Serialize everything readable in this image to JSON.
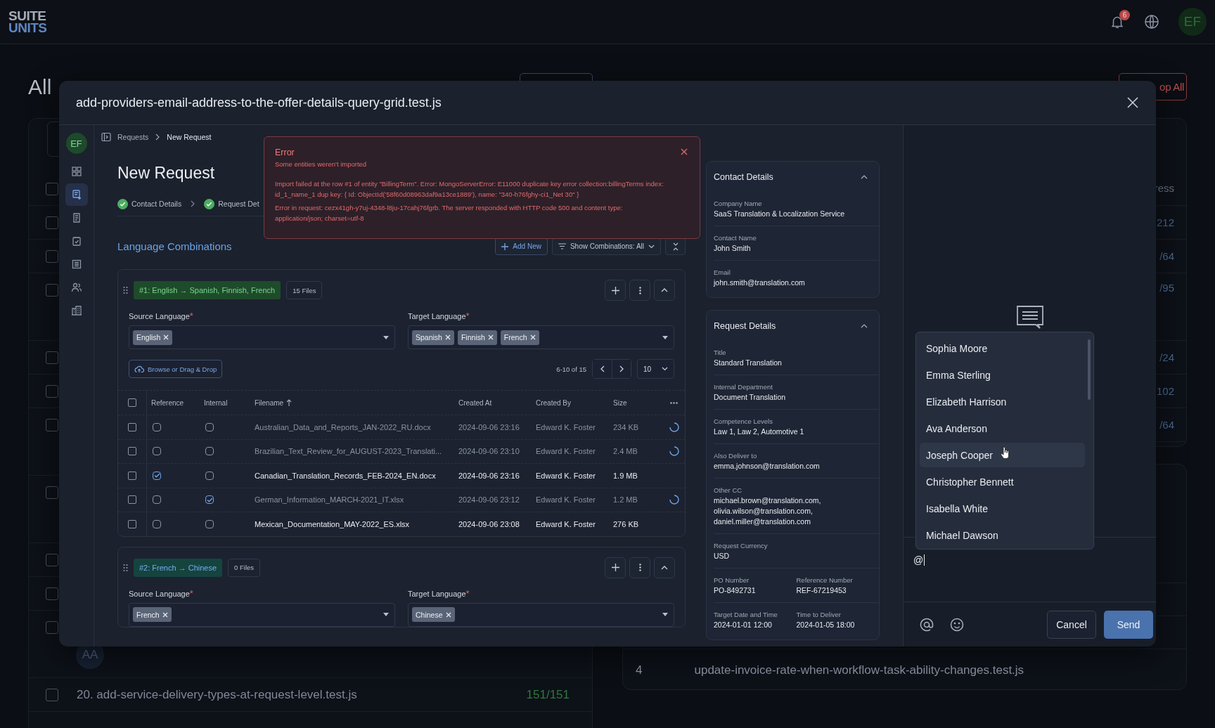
{
  "app_header": {
    "logo_top": "SUITE",
    "logo_bottom": "UNITS",
    "notification_count": "6",
    "avatar": "EF"
  },
  "background": {
    "title": "All",
    "stop_button": "op All",
    "left_rows": [
      {
        "checked": false
      },
      {
        "checked": false
      },
      {
        "checked": false
      },
      {
        "checked": false
      },
      {
        "checked": false
      },
      {
        "checked": false
      },
      {
        "checked": false
      },
      {
        "checked": false
      },
      {
        "checked": false
      },
      {
        "checked": false
      },
      {
        "checked": false
      }
    ],
    "avatar": "AA",
    "list_rows": [
      {
        "name": "20. add-service-delivery-types-at-request-level.test.js",
        "progress": "151/151",
        "checked": false,
        "passed": true
      }
    ],
    "right_header": "ress",
    "right_values": [
      "212",
      "/64",
      "/95",
      "/24",
      "102",
      "/64"
    ],
    "second_card_row": {
      "index": "4",
      "name": "update-invoice-rate-when-workflow-task-ability-changes.test.js"
    }
  },
  "modal": {
    "title": "add-providers-email-address-to-the-offer-details-query-grid.test.js",
    "user_avatar": "EF",
    "nav_items": [
      {
        "kind": "grid",
        "selected": false
      },
      {
        "kind": "new-request",
        "selected": true
      },
      {
        "kind": "invoice",
        "selected": false
      },
      {
        "kind": "tasks",
        "selected": false
      },
      {
        "kind": "list",
        "selected": false
      },
      {
        "kind": "people",
        "selected": false
      },
      {
        "kind": "company",
        "selected": false
      }
    ],
    "breadcrumb": [
      "Requests",
      "New Request"
    ],
    "page_title": "New Request",
    "steps": [
      {
        "label": "Contact Details",
        "done": true
      },
      {
        "label": "Request Det",
        "done": true
      }
    ],
    "error": {
      "title": "Error",
      "subtitle": "Some entities weren't imported",
      "messages": [
        "Import failed at the row #1 of entity \"BillingTerm\". Error: MongoServerError: E11000 duplicate key error collection:billingTerms index: id_1_name_1 dup key: { Id: ObjectId('58f60d08963daf9a13ce1889'), name: \"340-h76fghy-ci1_Net 30\" }",
        "Error in request: cezx41gh-y7uj-4348-l8ju-17cahj76fgrb. The server responded with HTTP code 500 and content type: application/json; charset=utf-8"
      ]
    },
    "section_title": "Language Combinations",
    "add_button": "Add New",
    "filter_button": "Show Combinations: All",
    "combinations": [
      {
        "kind": "with-files",
        "tag": "#1: English → Spanish,  Finnish, French",
        "files_count": "15 Files",
        "required_mark": "*",
        "all_selected": false,
        "source_label": "Source Language",
        "source": [
          "English"
        ],
        "target_label": "Target Language",
        "targets": [
          "Spanish",
          "Finnish",
          "French"
        ],
        "browse_button": "Browse or Drag & Drop",
        "pagination": "6-10 of 15",
        "page_size": "10",
        "columns": [
          "Reference",
          "Internal",
          "Filename",
          "Created At",
          "Created By",
          "Size"
        ],
        "rows": [
          {
            "selected": false,
            "reference": false,
            "internal": false,
            "filename": "Australian_Data_and_Reports_JAN-2022_RU.docx",
            "created_at": "2024-09-06 23:16",
            "created_by": "Edward K. Foster",
            "size": "234 KB",
            "processing": true
          },
          {
            "selected": false,
            "reference": false,
            "internal": false,
            "filename": "Brazilian_Text_Review_for_AUGUST-2023_Translati...",
            "created_at": "2024-09-06 23:10",
            "created_by": "Edward K. Foster",
            "size": "2.4 MB",
            "processing": true
          },
          {
            "selected": false,
            "reference": true,
            "internal": false,
            "filename": "Canadian_Translation_Records_FEB-2024_EN.docx",
            "created_at": "2024-09-06 23:16",
            "created_by": "Edward K. Foster",
            "size": "1.9 MB",
            "processing": false
          },
          {
            "selected": false,
            "reference": false,
            "internal": true,
            "filename": "German_Information_MARCH-2021_IT.xlsx",
            "created_at": "2024-09-06 23:12",
            "created_by": "Edward K. Foster",
            "size": "1.2 MB",
            "processing": true
          },
          {
            "selected": false,
            "reference": false,
            "internal": false,
            "filename": "Mexican_Documentation_MAY-2022_ES.xlsx",
            "created_at": "2024-09-06 23:08",
            "created_by": "Edward K. Foster",
            "size": "276 KB",
            "processing": false
          }
        ]
      },
      {
        "kind": "no-files",
        "tag": "#2: French → Chinese",
        "files_count": "0 Files",
        "required_mark": "*",
        "source_label": "Source Language",
        "source": [
          "French"
        ],
        "target_label": "Target Language",
        "targets": [
          "Chinese"
        ]
      }
    ],
    "details": [
      {
        "title": "Contact Details",
        "expanded": true,
        "fields": [
          {
            "kind": "text",
            "label": "Company Name",
            "value": "SaaS Translation & Localization Service"
          },
          {
            "kind": "text",
            "label": "Contact Name",
            "value": "John Smith"
          },
          {
            "kind": "text",
            "label": "Email",
            "value": "john.smith@translation.com"
          }
        ]
      },
      {
        "title": "Request Details",
        "expanded": true,
        "fields": [
          {
            "kind": "text",
            "label": "Title",
            "value": "Standard Translation"
          },
          {
            "kind": "text",
            "label": "Internal Department",
            "value": "Document Translation"
          },
          {
            "kind": "text",
            "label": "Competence Levels",
            "value": "Law 1, Law 2, Automotive 1"
          },
          {
            "kind": "text",
            "label": "Also Deliver to",
            "value": "emma.johnson@translation.com"
          },
          {
            "kind": "lines",
            "label": "Other CC",
            "lines": [
              "michael.brown@translation.com,",
              "olivia.wilson@translation.com,",
              "daniel.miller@translation.com"
            ]
          },
          {
            "kind": "text",
            "label": "Request Currency",
            "value": "USD"
          },
          {
            "kind": "pair",
            "items": [
              {
                "label": "PO Number",
                "value": "PO-8492731"
              },
              {
                "label": "Reference Number",
                "value": "REF-67219453"
              }
            ]
          },
          {
            "kind": "pair",
            "items": [
              {
                "label": "Target Date and Time",
                "value": "2024-01-01 12:00"
              },
              {
                "label": "Time to Deliver",
                "value": "2024-01-05 18:00"
              }
            ]
          }
        ]
      }
    ],
    "comments": {
      "mentions": [
        {
          "name": "Sophia Moore",
          "selected": false
        },
        {
          "name": "Emma Sterling",
          "selected": false
        },
        {
          "name": "Elizabeth Harrison",
          "selected": false
        },
        {
          "name": "Ava Anderson",
          "selected": false
        },
        {
          "name": "Joseph Cooper",
          "selected": true
        },
        {
          "name": "Christopher Bennett",
          "selected": false
        },
        {
          "name": "Isabella White",
          "selected": false
        },
        {
          "name": "Michael Dawson",
          "selected": false
        }
      ],
      "input_value": "@",
      "cancel": "Cancel",
      "send": "Send"
    }
  }
}
